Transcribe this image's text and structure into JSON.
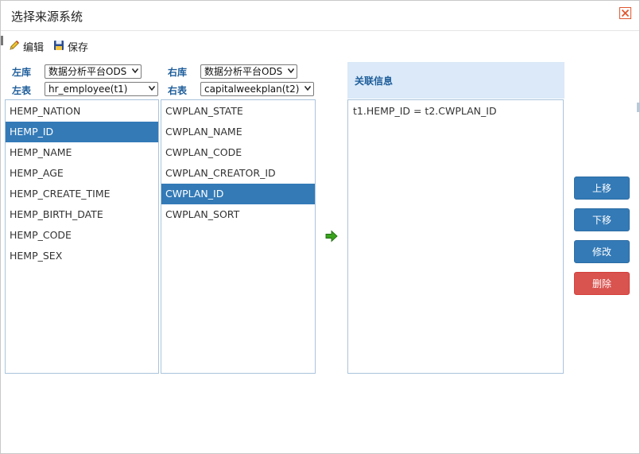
{
  "dialog": {
    "title": "选择来源系统"
  },
  "toolbar": {
    "edit_label": "编辑",
    "save_label": "保存"
  },
  "left": {
    "db_label": "左库",
    "db_value": "数据分析平台ODS",
    "table_label": "左表",
    "table_value": "hr_employee(t1)",
    "fields": [
      "HEMP_NATION",
      "HEMP_ID",
      "HEMP_NAME",
      "HEMP_AGE",
      "HEMP_CREATE_TIME",
      "HEMP_BIRTH_DATE",
      "HEMP_CODE",
      "HEMP_SEX"
    ],
    "selected_field": "HEMP_ID"
  },
  "right": {
    "db_label": "右库",
    "db_value": "数据分析平台ODS",
    "table_label": "右表",
    "table_value": "capitalweekplan(t2)",
    "fields": [
      "CWPLAN_STATE",
      "CWPLAN_NAME",
      "CWPLAN_CODE",
      "CWPLAN_CREATOR_ID",
      "CWPLAN_ID",
      "CWPLAN_SORT"
    ],
    "selected_field": "CWPLAN_ID"
  },
  "relation": {
    "header": "关联信息",
    "items": [
      "t1.HEMP_ID = t2.CWPLAN_ID"
    ]
  },
  "actions": {
    "move_up": "上移",
    "move_down": "下移",
    "modify": "修改",
    "delete": "删除"
  },
  "icons": {
    "close": "close-icon",
    "edit": "pencil-icon",
    "save": "floppy-disk-icon",
    "add": "green-arrow-right-icon"
  },
  "colors": {
    "primary": "#337ab7",
    "danger": "#d9534f",
    "header_bg": "#dbe9f8",
    "label": "#1d5d9a",
    "add_arrow": "#3aa31e"
  }
}
